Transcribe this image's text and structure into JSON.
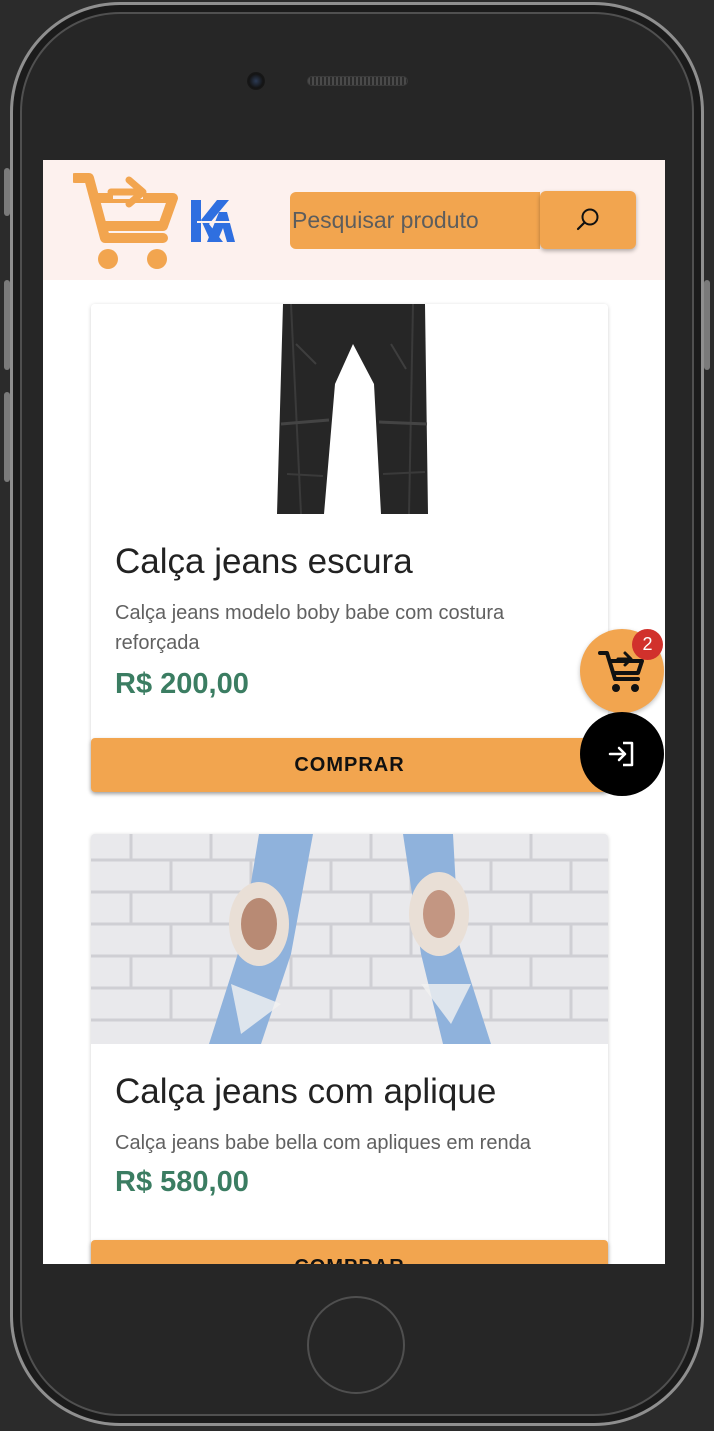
{
  "header": {
    "search_placeholder": "Pesquisar produto"
  },
  "products": [
    {
      "title": "Calça jeans escura",
      "description": "Calça jeans modelo boby babe com costura reforçada",
      "price": "R$ 200,00",
      "buy_label": "COMPRAR"
    },
    {
      "title": "Calça jeans com aplique",
      "description": "Calça jeans babe bella com apliques em renda",
      "price": "R$ 580,00",
      "buy_label": "COMPRAR"
    }
  ],
  "cart": {
    "count": "2"
  },
  "colors": {
    "accent": "#f2a54f",
    "price": "#3b7d62",
    "badge": "#d1312c",
    "header_bg": "#fdf1ee",
    "logo_blue": "#2f6fe0"
  },
  "icons": [
    "cart-logo-icon",
    "km-logo-icon",
    "search-icon",
    "shopping-cart-icon",
    "login-icon"
  ]
}
